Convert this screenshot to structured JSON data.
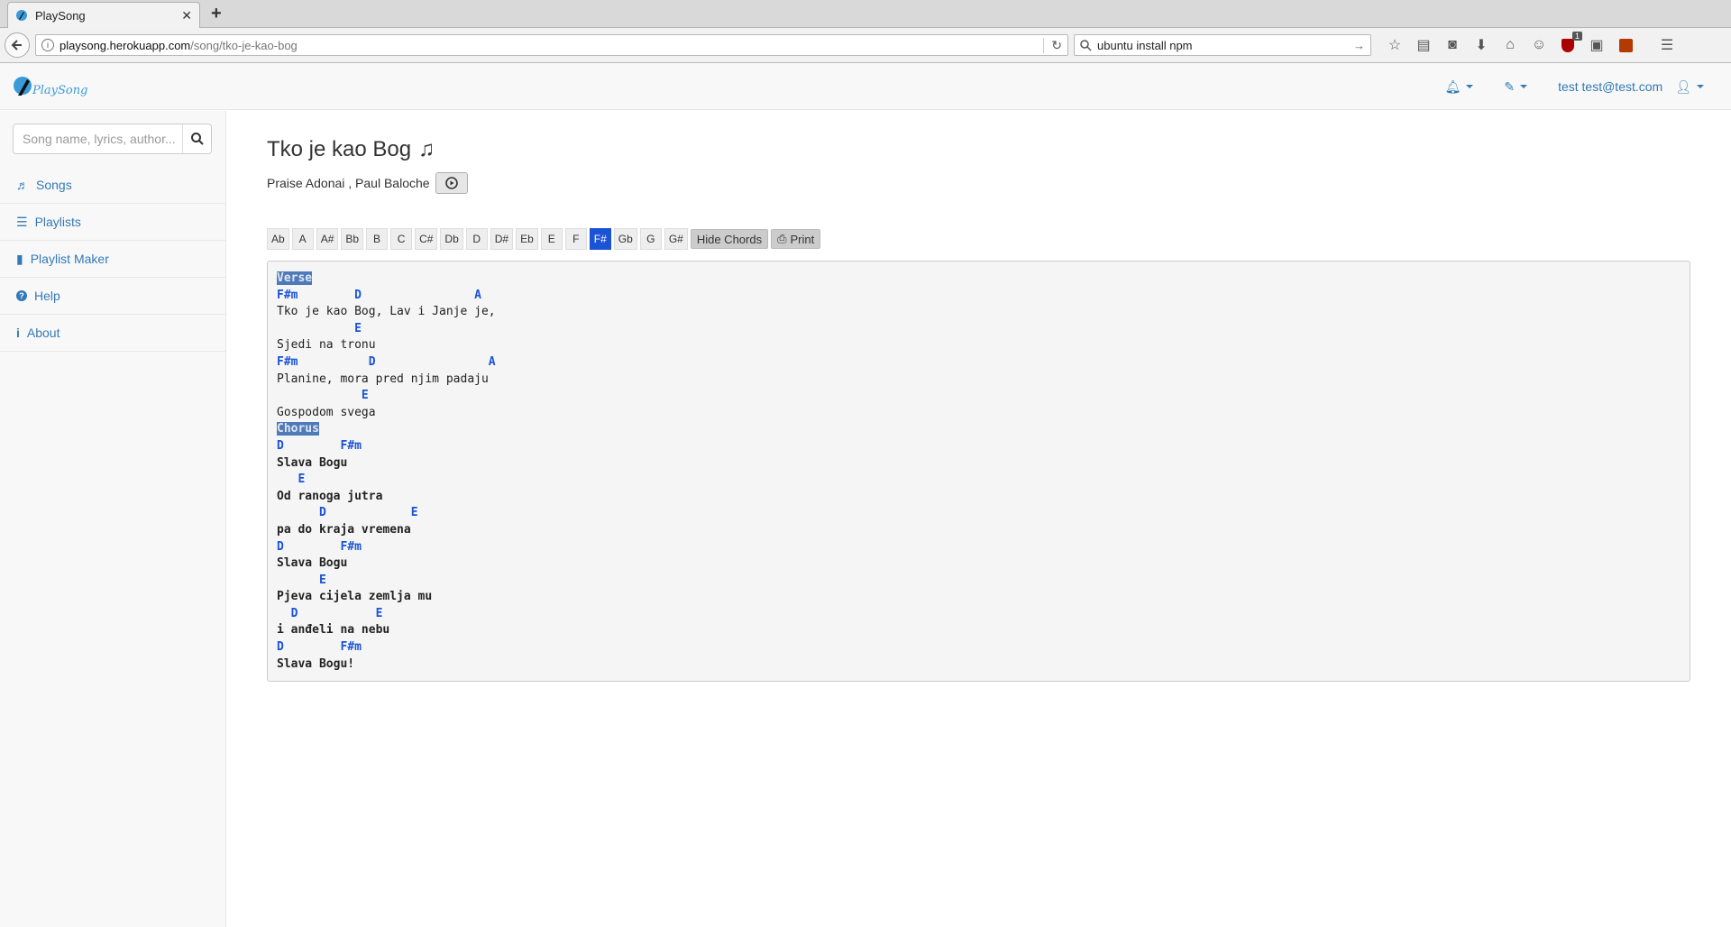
{
  "browser": {
    "tab_title": "PlaySong",
    "url_host": "playsong.herokuapp.com",
    "url_path": "/song/tko-je-kao-bog",
    "search_value": "ubuntu install npm",
    "badge_count": "1"
  },
  "header": {
    "brand": "PlaySong",
    "user_label": "test test@test.com"
  },
  "sidebar": {
    "search_placeholder": "Song name, lyrics, author...",
    "items": [
      {
        "label": "Songs",
        "icon": "music-icon"
      },
      {
        "label": "Playlists",
        "icon": "list-icon"
      },
      {
        "label": "Playlist Maker",
        "icon": "book-icon"
      },
      {
        "label": "Help",
        "icon": "question-icon"
      },
      {
        "label": "About",
        "icon": "info-icon"
      }
    ]
  },
  "song": {
    "title": "Tko je kao Bog",
    "authors": "Praise Adonai , Paul Baloche",
    "keys": [
      "Ab",
      "A",
      "A#",
      "Bb",
      "B",
      "C",
      "C#",
      "Db",
      "D",
      "D#",
      "Eb",
      "E",
      "F",
      "F#",
      "Gb",
      "G",
      "G#"
    ],
    "active_key": "F#",
    "hide_chords_label": "Hide Chords",
    "print_label": "Print",
    "lines": [
      {
        "type": "section",
        "text": "Verse"
      },
      {
        "type": "chord",
        "text": "F#m        D                A"
      },
      {
        "type": "lyric",
        "text": "Tko je kao Bog, Lav i Janje je,"
      },
      {
        "type": "chord",
        "text": "           E"
      },
      {
        "type": "lyric",
        "text": "Sjedi na tronu"
      },
      {
        "type": "chord",
        "text": "F#m          D                A"
      },
      {
        "type": "lyric",
        "text": "Planine, mora pred njim padaju"
      },
      {
        "type": "chord",
        "text": "            E"
      },
      {
        "type": "lyric",
        "text": "Gospodom svega"
      },
      {
        "type": "section",
        "text": "Chorus"
      },
      {
        "type": "chord",
        "text": "D        F#m"
      },
      {
        "type": "lyricb",
        "text": "Slava Bogu"
      },
      {
        "type": "chord",
        "text": "   E"
      },
      {
        "type": "lyricb",
        "text": "Od ranoga jutra"
      },
      {
        "type": "chord",
        "text": "      D            E"
      },
      {
        "type": "lyricb",
        "text": "pa do kraja vremena"
      },
      {
        "type": "chord",
        "text": "D        F#m"
      },
      {
        "type": "lyricb",
        "text": "Slava Bogu"
      },
      {
        "type": "chord",
        "text": "      E"
      },
      {
        "type": "lyricb",
        "text": "Pjeva cijela zemlja mu"
      },
      {
        "type": "chord",
        "text": "  D           E"
      },
      {
        "type": "lyricb",
        "text": "i anđeli na nebu"
      },
      {
        "type": "chord",
        "text": "D        F#m"
      },
      {
        "type": "lyricb",
        "text": "Slava Bogu!"
      }
    ]
  }
}
